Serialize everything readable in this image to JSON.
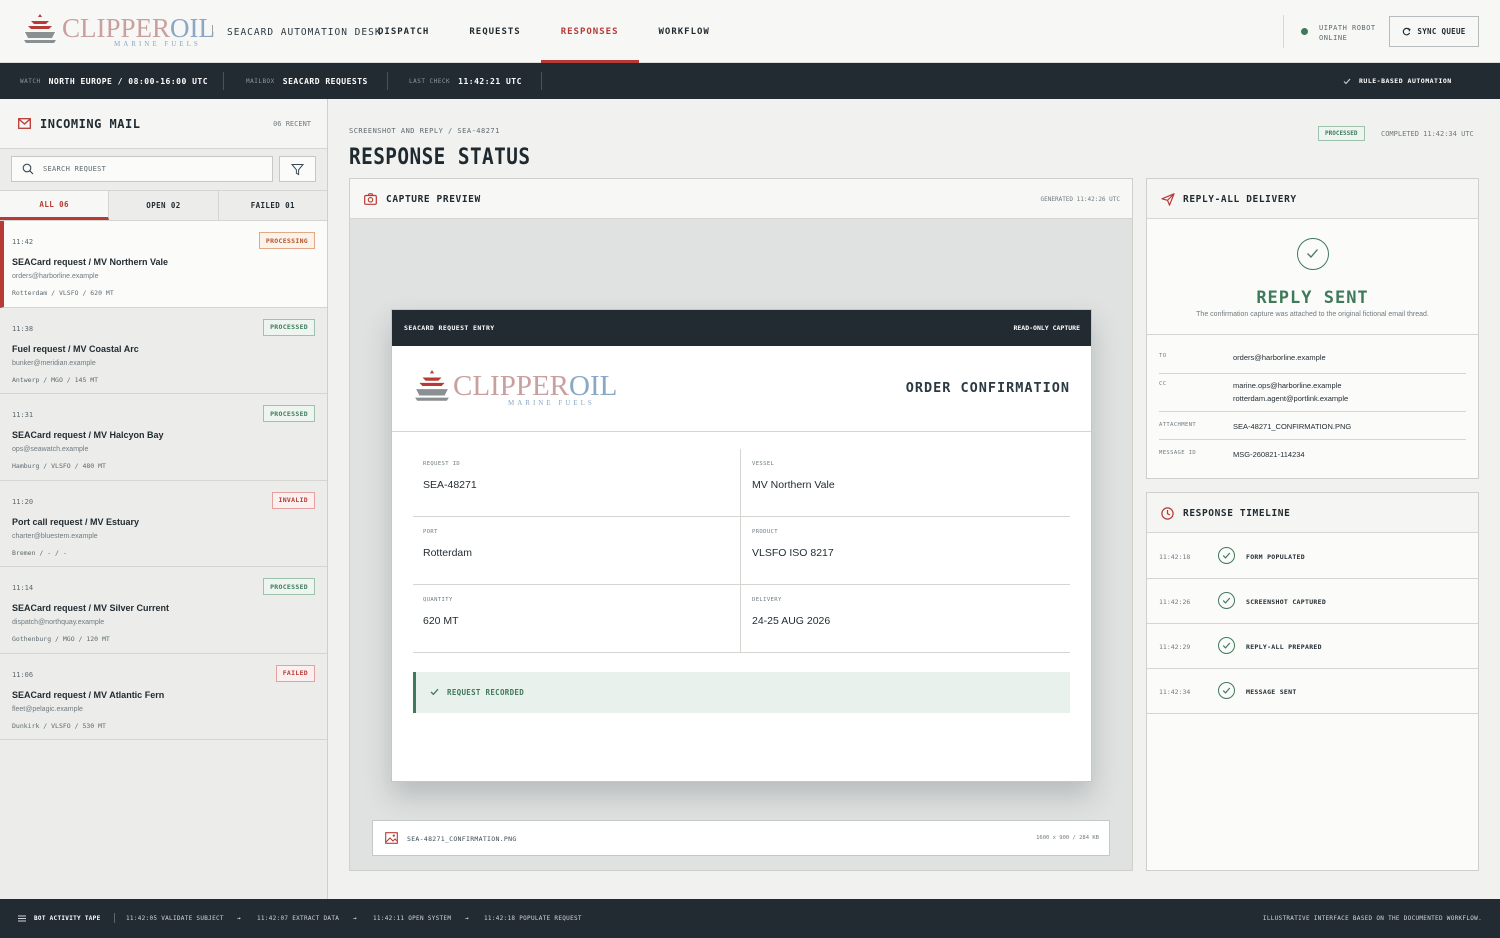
{
  "brand": {
    "clipper": "CLIPPER",
    "oil": "OIL",
    "sub": "MARINE FUELS"
  },
  "header": {
    "desk_title": "SEACARD AUTOMATION DESK",
    "nav": [
      "DISPATCH",
      "REQUESTS",
      "RESPONSES",
      "WORKFLOW"
    ],
    "active_nav": "RESPONSES",
    "robot_line1": "UIPATH ROBOT",
    "robot_line2": "ONLINE",
    "sync_label": "SYNC QUEUE"
  },
  "strip": {
    "watch_k": "WATCH",
    "watch_v": "NORTH EUROPE / 08:00-16:00 UTC",
    "mailbox_k": "MAILBOX",
    "mailbox_v": "SEACARD REQUESTS",
    "last_k": "LAST CHECK",
    "last_v": "11:42:21 UTC",
    "mode": "RULE-BASED AUTOMATION"
  },
  "inbox": {
    "title": "INCOMING MAIL",
    "recent": "06 RECENT",
    "search_placeholder": "SEARCH REQUEST",
    "tabs": [
      "ALL 06",
      "OPEN 02",
      "FAILED 01"
    ],
    "items": [
      {
        "time": "11:42",
        "subject": "SEACard request / MV Northern Vale",
        "from": "orders@harborline.example",
        "meta": "Rotterdam / VLSFO / 620 MT",
        "status": "PROCESSING"
      },
      {
        "time": "11:38",
        "subject": "Fuel request / MV Coastal Arc",
        "from": "bunker@meridian.example",
        "meta": "Antwerp / MGO / 145 MT",
        "status": "PROCESSED"
      },
      {
        "time": "11:31",
        "subject": "SEACard request / MV Halcyon Bay",
        "from": "ops@seawatch.example",
        "meta": "Hamburg / VLSFO / 480 MT",
        "status": "PROCESSED"
      },
      {
        "time": "11:20",
        "subject": "Port call request / MV Estuary",
        "from": "charter@bluestem.example",
        "meta": "Bremen / - / -",
        "status": "INVALID"
      },
      {
        "time": "11:14",
        "subject": "SEACard request / MV Silver Current",
        "from": "dispatch@northquay.example",
        "meta": "Gothenburg / MGO / 120 MT",
        "status": "PROCESSED"
      },
      {
        "time": "11:06",
        "subject": "SEACard request / MV Atlantic Fern",
        "from": "fleet@pelagic.example",
        "meta": "Dunkirk / VLSFO / 530 MT",
        "status": "FAILED"
      }
    ]
  },
  "main": {
    "crumb": "SCREENSHOT AND REPLY / SEA-48271",
    "title": "RESPONSE STATUS",
    "status": "PROCESSED",
    "completed": "COMPLETED 11:42:34 UTC",
    "preview_title": "CAPTURE PREVIEW",
    "generated": "GENERATED 11:42:26 UTC",
    "capture": {
      "bar_left": "SEACARD REQUEST ENTRY",
      "bar_right": "READ-ONLY CAPTURE",
      "doc_title": "ORDER CONFIRMATION",
      "fields": [
        {
          "k": "REQUEST ID",
          "v": "SEA-48271"
        },
        {
          "k": "VESSEL",
          "v": "MV Northern Vale"
        },
        {
          "k": "PORT",
          "v": "Rotterdam"
        },
        {
          "k": "PRODUCT",
          "v": "VLSFO ISO 8217"
        },
        {
          "k": "QUANTITY",
          "v": "620 MT"
        },
        {
          "k": "DELIVERY",
          "v": "24-25 AUG 2026"
        }
      ],
      "recorded": "REQUEST RECORDED"
    },
    "file_name": "SEA-48271_CONFIRMATION.PNG",
    "file_meta": "1600 x 900 / 284 KB"
  },
  "delivery": {
    "title": "REPLY-ALL DELIVERY",
    "sent": "REPLY SENT",
    "note": "The confirmation capture was attached to the original fictional email thread.",
    "to_k": "TO",
    "to_v": "orders@harborline.example",
    "cc_k": "CC",
    "cc_v1": "marine.ops@harborline.example",
    "cc_v2": "rotterdam.agent@portlink.example",
    "att_k": "ATTACHMENT",
    "att_v": "SEA-48271_CONFIRMATION.PNG",
    "msg_k": "MESSAGE ID",
    "msg_v": "MSG-260821-114234"
  },
  "timeline": {
    "title": "RESPONSE TIMELINE",
    "items": [
      {
        "time": "11:42:18",
        "label": "FORM POPULATED"
      },
      {
        "time": "11:42:26",
        "label": "SCREENSHOT CAPTURED"
      },
      {
        "time": "11:42:29",
        "label": "REPLY-ALL PREPARED"
      },
      {
        "time": "11:42:34",
        "label": "MESSAGE SENT"
      }
    ]
  },
  "footer": {
    "tape": "BOT ACTIVITY TAPE",
    "steps": [
      "11:42:05 VALIDATE SUBJECT",
      "11:42:07 EXTRACT DATA",
      "11:42:11 OPEN SYSTEM",
      "11:42:18 POPULATE REQUEST"
    ],
    "note": "ILLUSTRATIVE INTERFACE BASED ON THE DOCUMENTED WORKFLOW."
  },
  "colors": {
    "accent": "#b73a35",
    "success": "#3f7a5a",
    "dark": "#222b31",
    "warning": "#b4562b"
  }
}
